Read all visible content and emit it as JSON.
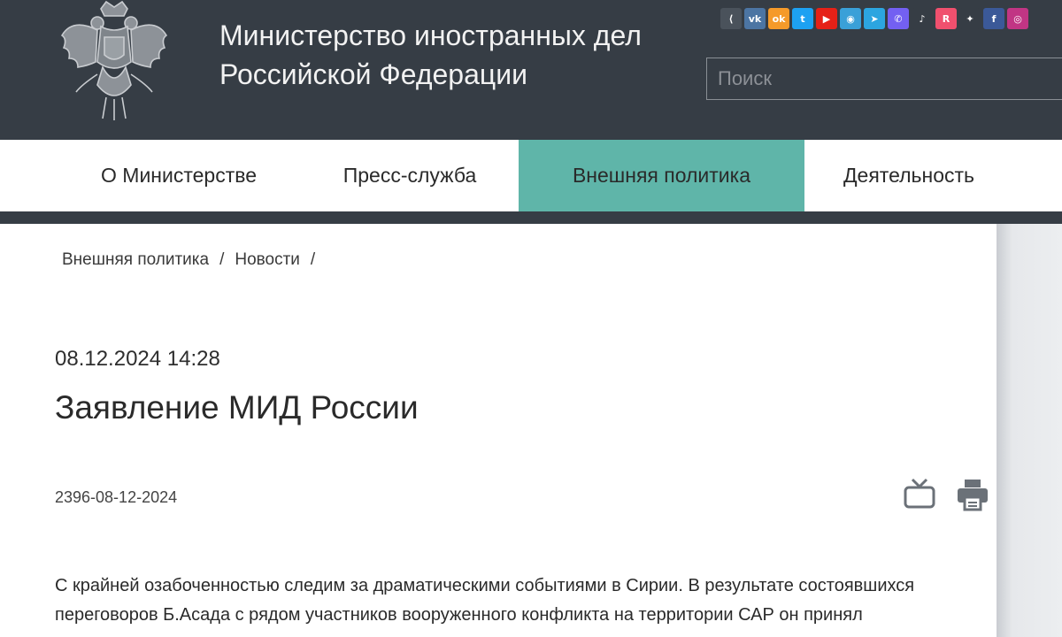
{
  "header": {
    "title_line1": "Министерство иностранных дел",
    "title_line2": "Российской Федерации",
    "search_placeholder": "Поиск",
    "emblem_icon": "double-headed-eagle-emblem",
    "socials": [
      {
        "name": "share-icon",
        "glyph": "⟨",
        "color": "#4a525b"
      },
      {
        "name": "vk-icon",
        "glyph": "vk",
        "color": "#4c75a3"
      },
      {
        "name": "odnoklassniki-icon",
        "glyph": "ok",
        "color": "#f59a2a"
      },
      {
        "name": "twitter-icon",
        "glyph": "t",
        "color": "#1da1f2"
      },
      {
        "name": "youtube-icon",
        "glyph": "▶",
        "color": "#e62117"
      },
      {
        "name": "map-pin-icon",
        "glyph": "◉",
        "color": "#3aa0d8"
      },
      {
        "name": "telegram-icon",
        "glyph": "➤",
        "color": "#2ca5e0"
      },
      {
        "name": "viber-icon",
        "glyph": "✆",
        "color": "#7360f2"
      },
      {
        "name": "tiktok-icon",
        "glyph": "♪",
        "color": "#363d45"
      },
      {
        "name": "rutube-icon",
        "glyph": "R",
        "color": "#f0506e"
      },
      {
        "name": "sparkle-icon",
        "glyph": "✦",
        "color": "#363d45"
      },
      {
        "name": "facebook-icon",
        "glyph": "f",
        "color": "#3b5998"
      },
      {
        "name": "instagram-icon",
        "glyph": "◎",
        "color": "#c13584"
      }
    ]
  },
  "nav": {
    "items": [
      {
        "label": "О Министерстве",
        "active": false
      },
      {
        "label": "Пресс-служба",
        "active": false
      },
      {
        "label": "Внешняя политика",
        "active": true
      },
      {
        "label": "Деятельность",
        "active": false
      }
    ]
  },
  "breadcrumb": {
    "items": [
      "Внешняя политика",
      "Новости"
    ],
    "separator": "/"
  },
  "article": {
    "date": "08.12.2024 14:28",
    "title": "Заявление МИД России",
    "doc_number": "2396-08-12-2024",
    "text_line1": "С крайней озабоченностью следим за драматическими событиями в Сирии. В результате состоявшихся",
    "text_line2": "переговоров Б.Асада с рядом участников вооруженного конфликта на территории САР он принял"
  },
  "colors": {
    "header_bg": "#363d45",
    "nav_active": "#5fb5a9",
    "tool_icon": "#6b7178"
  }
}
